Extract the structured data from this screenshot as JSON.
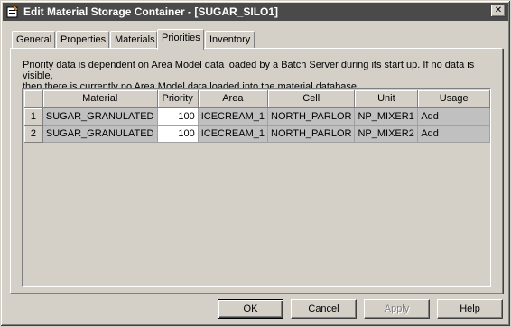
{
  "window": {
    "title": "Edit Material Storage Container - [SUGAR_SILO1]",
    "close_glyph": "✕",
    "titlebar_color": "#4a4a4a"
  },
  "tabs": [
    {
      "label": "General"
    },
    {
      "label": "Properties"
    },
    {
      "label": "Materials"
    },
    {
      "label": "Priorities",
      "active": true
    },
    {
      "label": "Inventory"
    }
  ],
  "panel": {
    "description_line1": "Priority data is dependent on Area Model data loaded by a Batch Server during its start up. If no data is visible,",
    "description_line2": "then there is currently no Area Model data loaded into the material database."
  },
  "grid": {
    "columns": [
      "",
      "Material",
      "Priority",
      "Area",
      "Cell",
      "Unit",
      "Usage"
    ],
    "rows": [
      {
        "num": "1",
        "material": "SUGAR_GRANULATED",
        "priority": "100",
        "area": "ICECREAM_1",
        "cell": "NORTH_PARLOR",
        "unit": "NP_MIXER1",
        "usage": "Add"
      },
      {
        "num": "2",
        "material": "SUGAR_GRANULATED",
        "priority": "100",
        "area": "ICECREAM_1",
        "cell": "NORTH_PARLOR",
        "unit": "NP_MIXER2",
        "usage": "Add"
      }
    ]
  },
  "buttons": {
    "ok": "OK",
    "cancel": "Cancel",
    "apply": "Apply",
    "help": "Help"
  }
}
